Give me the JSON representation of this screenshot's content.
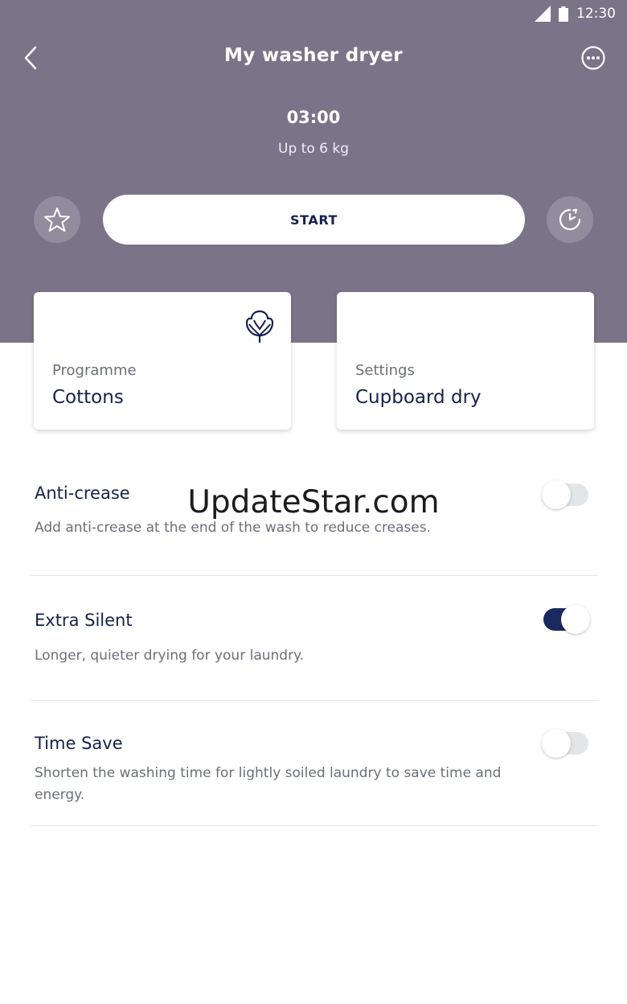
{
  "status_bar": {
    "time": "12:30"
  },
  "header": {
    "title": "My washer dryer",
    "duration": "03:00",
    "load": "Up to 6 kg",
    "start_label": "START"
  },
  "cards": {
    "programme": {
      "label": "Programme",
      "value": "Cottons",
      "icon": "cotton-icon"
    },
    "settings": {
      "label": "Settings",
      "value": "Cupboard dry"
    }
  },
  "options": [
    {
      "title": "Anti-crease",
      "description": "Add anti-crease at the end of the wash to reduce creases.",
      "enabled": false
    },
    {
      "title": "Extra Silent",
      "description": "Longer, quieter drying for your laundry.",
      "enabled": true
    },
    {
      "title": "Time Save",
      "description": "Shorten the washing time for lightly soiled laundry to save time and energy.",
      "enabled": false
    }
  ],
  "watermark": "UpdateStar.com",
  "colors": {
    "header_bg": "#7b7489",
    "accent": "#1b2a5e",
    "text_primary": "#16224a",
    "text_secondary": "#6b6f7c"
  }
}
